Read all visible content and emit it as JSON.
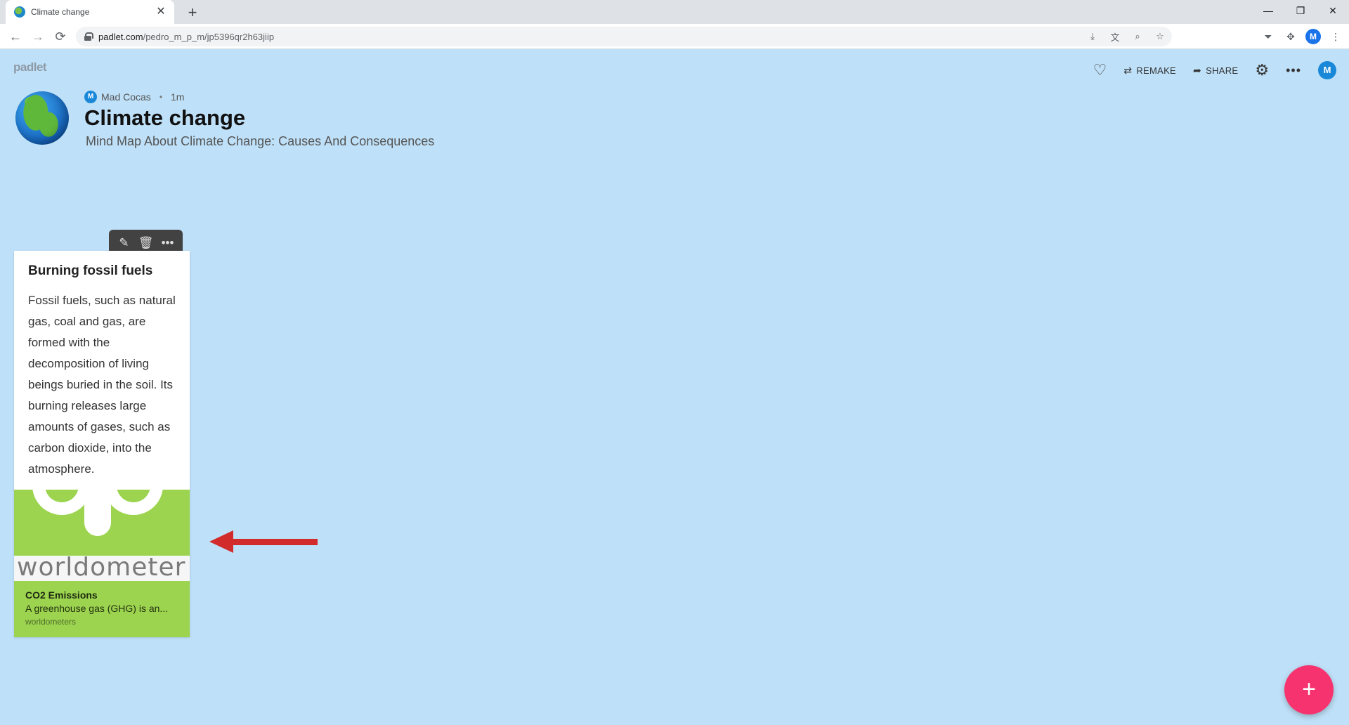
{
  "browser": {
    "tab_title": "Climate change",
    "tab_close": "✕",
    "new_tab": "+",
    "url_host": "padlet.com",
    "url_path": "/pedro_m_p_m/jp5396qr2h63jiip",
    "profile_initial": "M",
    "window_controls": {
      "minimize": "—",
      "restore": "❐",
      "close": "✕"
    }
  },
  "header": {
    "logo": "padlet",
    "remake_label": "REMAKE",
    "share_label": "SHARE",
    "avatar_initial": "M"
  },
  "padlet": {
    "author_initial": "M",
    "author_name": "Mad Cocas",
    "time_ago": "1m",
    "title": "Climate change",
    "subtitle": "Mind Map About Climate Change: Causes And Consequences"
  },
  "post": {
    "title": "Burning fossil fuels",
    "body": "Fossil fuels, such as natural gas, coal and gas, are formed with the decomposition of living beings buried in the soil. Its burning releases large amounts of gases, such as carbon dioxide, into the atmosphere.",
    "attachment": {
      "image_wordmark": "worldometer",
      "title": "CO2 Emissions",
      "description": "A greenhouse gas (GHG) is an...",
      "source": "worldometers"
    }
  },
  "fab_label": "+",
  "colors": {
    "background": "#bee0f8",
    "fab": "#f6336f",
    "attachment_green": "#9cd450",
    "annotation_arrow": "#d22b2b"
  }
}
